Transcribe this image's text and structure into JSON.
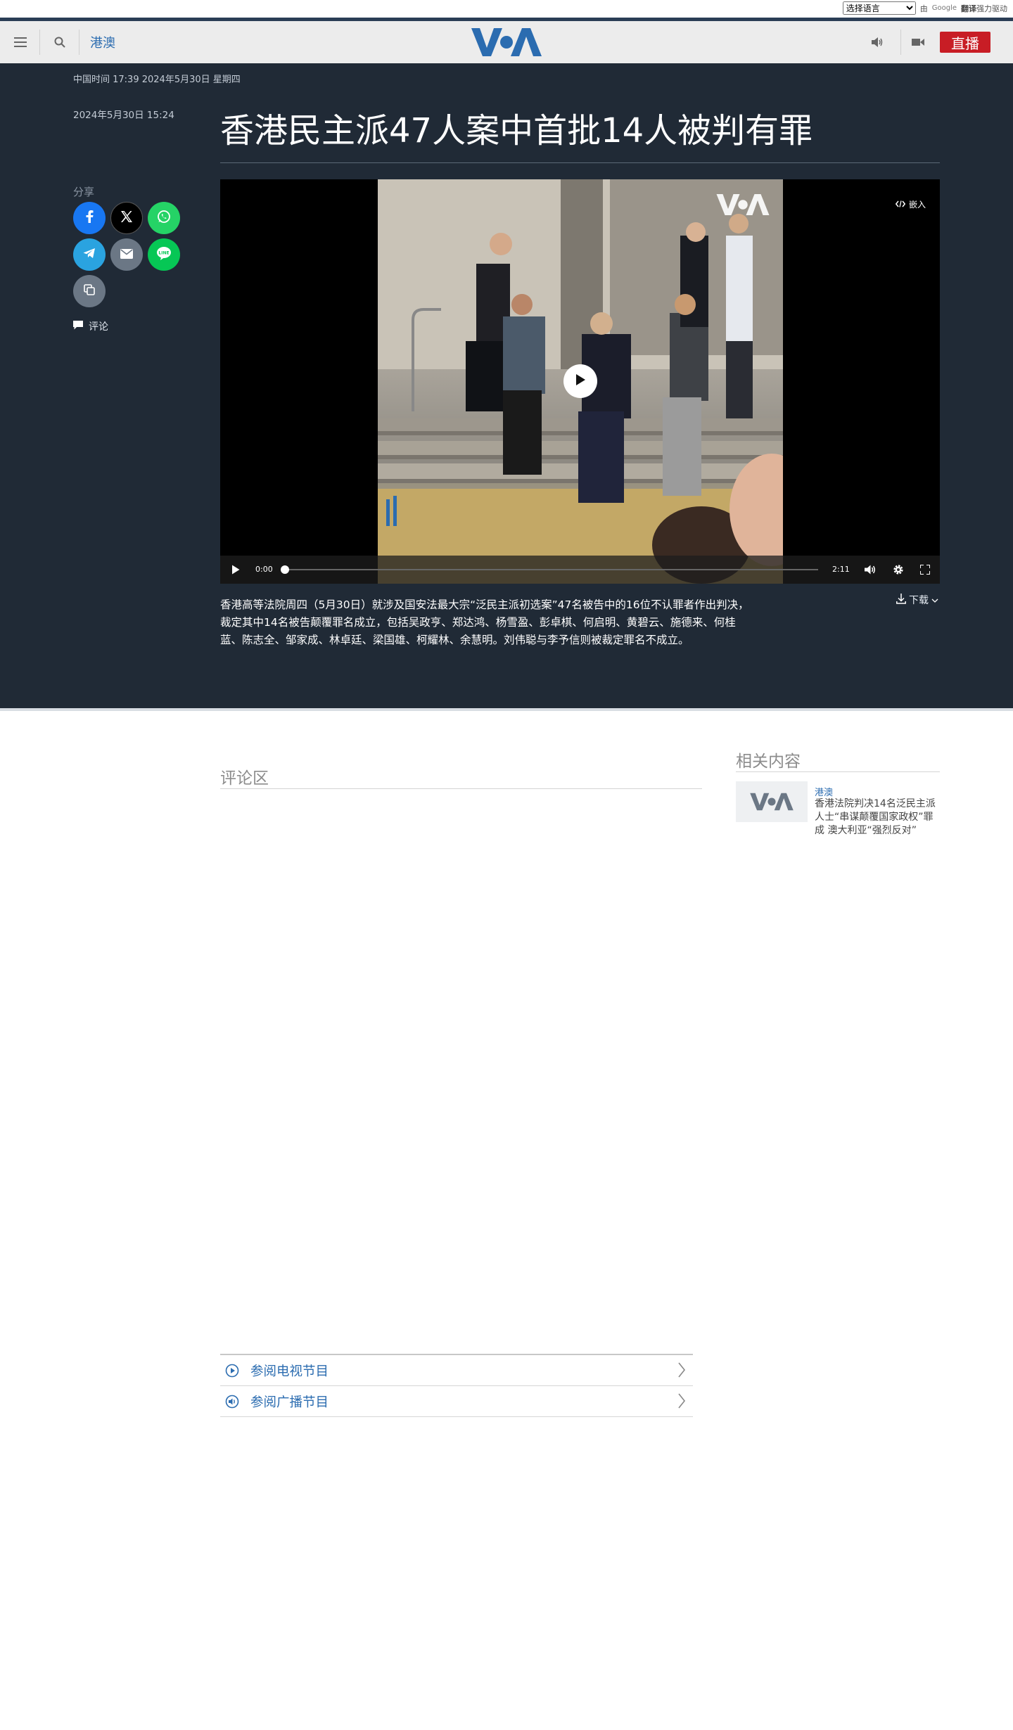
{
  "translate_bar": {
    "select_label": "选择语言",
    "by_text": "由",
    "google_text": "Google",
    "translate_bold": "翻译",
    "powered_text": "强力驱动"
  },
  "header": {
    "section_link": "港澳",
    "logo_text": "VOA",
    "live_label": "直播"
  },
  "article": {
    "china_time": "中国时间 17:39 2024年5月30日 星期四",
    "publish_date": "2024年5月30日 15:24",
    "title": "香港民主派47人案中首批14人被判有罪",
    "share_label": "分享",
    "comments_label": "评论",
    "video": {
      "embed_label": "嵌入",
      "current_time": "0:00",
      "duration": "2:11",
      "progress": 0,
      "watermark": "VOA"
    },
    "download_label": "下载",
    "caption": "香港高等法院周四（5月30日）就涉及国安法最大宗“泛民主派初选案”47名被告中的16位不认罪者作出判决，裁定其中14名被告颠覆罪名成立，包括吴政亨、郑达鸿、杨雪盈、彭卓棋、何启明、黄碧云、施德来、何桂蓝、陈志全、邹家成、林卓廷、梁国雄、柯耀林、余慧明。刘伟聪与李予信则被裁定罪名不成立。"
  },
  "share_buttons": [
    {
      "name": "facebook",
      "color": "#1877f2"
    },
    {
      "name": "x",
      "color": "#000000"
    },
    {
      "name": "whatsapp",
      "color": "#25d366"
    },
    {
      "name": "telegram",
      "color": "#2aa3e0"
    },
    {
      "name": "email",
      "color": "#6b7785"
    },
    {
      "name": "line",
      "color": "#06c755"
    },
    {
      "name": "copy-link",
      "color": "#6b7785"
    }
  ],
  "related": {
    "heading": "相关内容",
    "items": [
      {
        "category": "港澳",
        "title": "香港法院判决14名泛民主派人士“串谋颠覆国家政权”罪成 澳大利亚“强烈反对”"
      }
    ]
  },
  "comments_section": {
    "heading": "评论区"
  },
  "programs": [
    {
      "label": "参阅电视节目",
      "icon": "play-circle-icon"
    },
    {
      "label": "参阅广播节目",
      "icon": "speaker-circle-icon"
    }
  ],
  "colors": {
    "brand_blue": "#2b6cb0",
    "live_red": "#c81d25",
    "dark_bg": "#202a36",
    "header_bg": "#ececec"
  }
}
